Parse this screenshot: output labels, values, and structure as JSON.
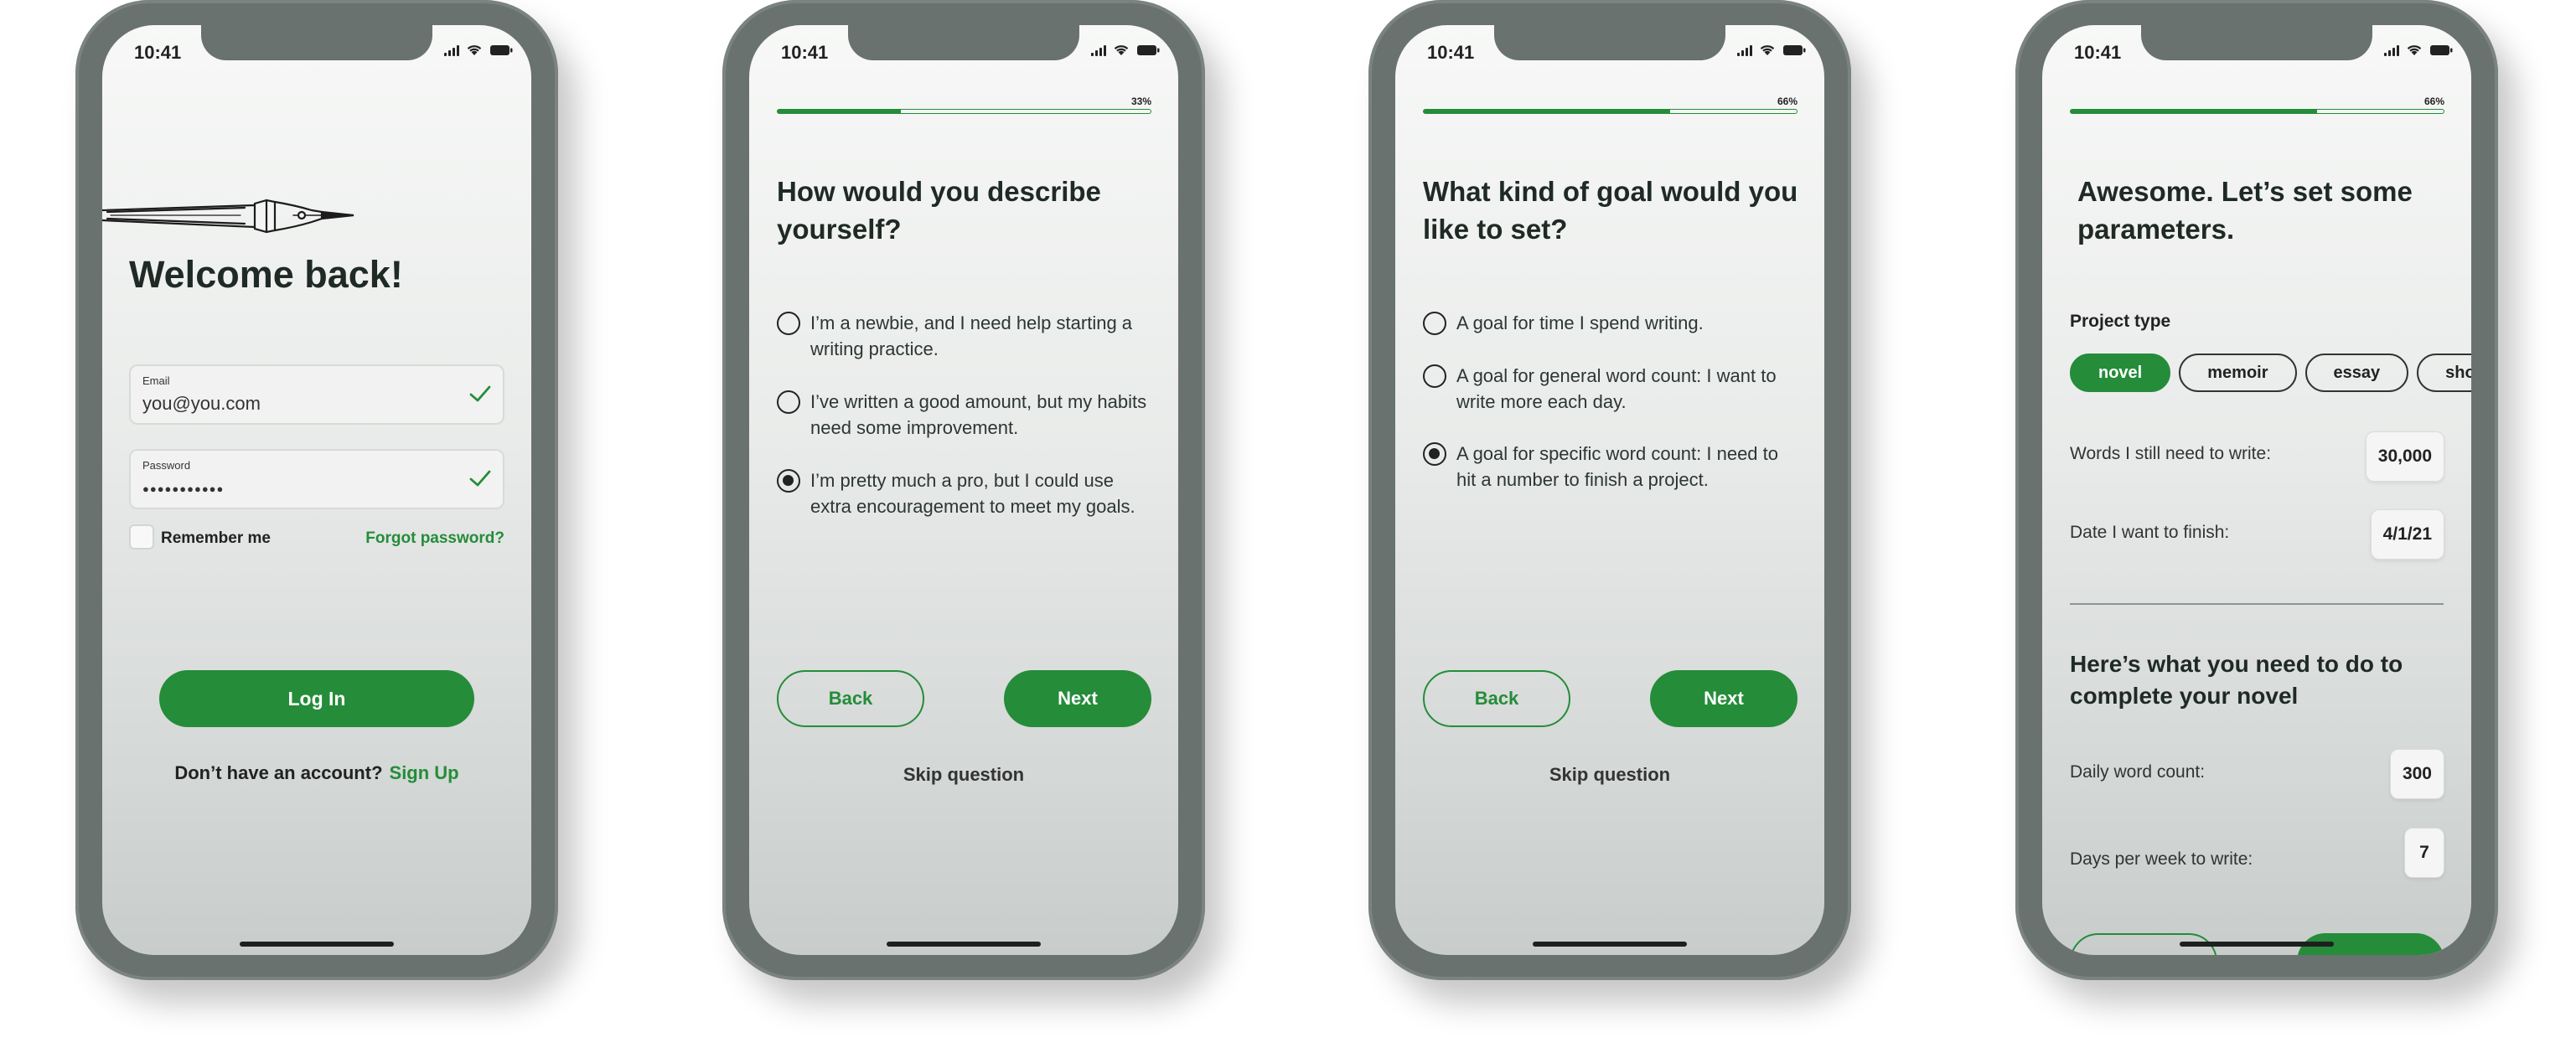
{
  "status_bar": {
    "time": "10:41"
  },
  "login": {
    "title": "Welcome back!",
    "email": {
      "label": "Email",
      "value": "you@you.com"
    },
    "password": {
      "label": "Password",
      "value": "●●●●●●●●●●●"
    },
    "remember_label": "Remember me",
    "remember_checked": false,
    "forgot_label": "Forgot password?",
    "login_label": "Log In",
    "no_account_text": "Don’t have an account?",
    "signup_label": "Sign Up"
  },
  "question1": {
    "progress": 0.33,
    "progress_label": "33%",
    "title": "How would you describe yourself?",
    "options": [
      {
        "label": "I’m a newbie, and I need help starting a writing practice.",
        "selected": false
      },
      {
        "label": "I’ve written a good amount, but my habits need some improvement.",
        "selected": false
      },
      {
        "label": "I’m pretty much a pro, but I could use extra encouragement to meet my goals.",
        "selected": true
      }
    ],
    "back_label": "Back",
    "next_label": "Next",
    "skip_label": "Skip question"
  },
  "question2": {
    "progress": 0.66,
    "progress_label": "66%",
    "title": "What kind of goal would you like to set?",
    "options": [
      {
        "label": "A goal for time I spend writing.",
        "selected": false
      },
      {
        "label": "A goal for general word count: I want to write more each day.",
        "selected": false
      },
      {
        "label": "A goal for specific word count: I need to hit a number to finish a project.",
        "selected": true
      }
    ],
    "back_label": "Back",
    "next_label": "Next",
    "skip_label": "Skip question"
  },
  "parameters": {
    "progress": 0.66,
    "progress_label": "66%",
    "title": "Awesome. Let’s set some parameters.",
    "project_type_label": "Project type",
    "project_types": [
      "novel",
      "memoir",
      "essay",
      "sho"
    ],
    "selected_project_type": "novel",
    "words_label": "Words I still need to write:",
    "words_value": "30,000",
    "date_label": "Date I want to finish:",
    "date_value": "4/1/21",
    "plan_title": "Here’s what you need to do to complete your novel",
    "daily_label": "Daily word count:",
    "daily_value": "300",
    "days_label": "Days per week to write:",
    "days_value": "7"
  },
  "colors": {
    "accent": "#258c3a",
    "phone_frame": "#6a726f",
    "text": "#1f2a25"
  }
}
